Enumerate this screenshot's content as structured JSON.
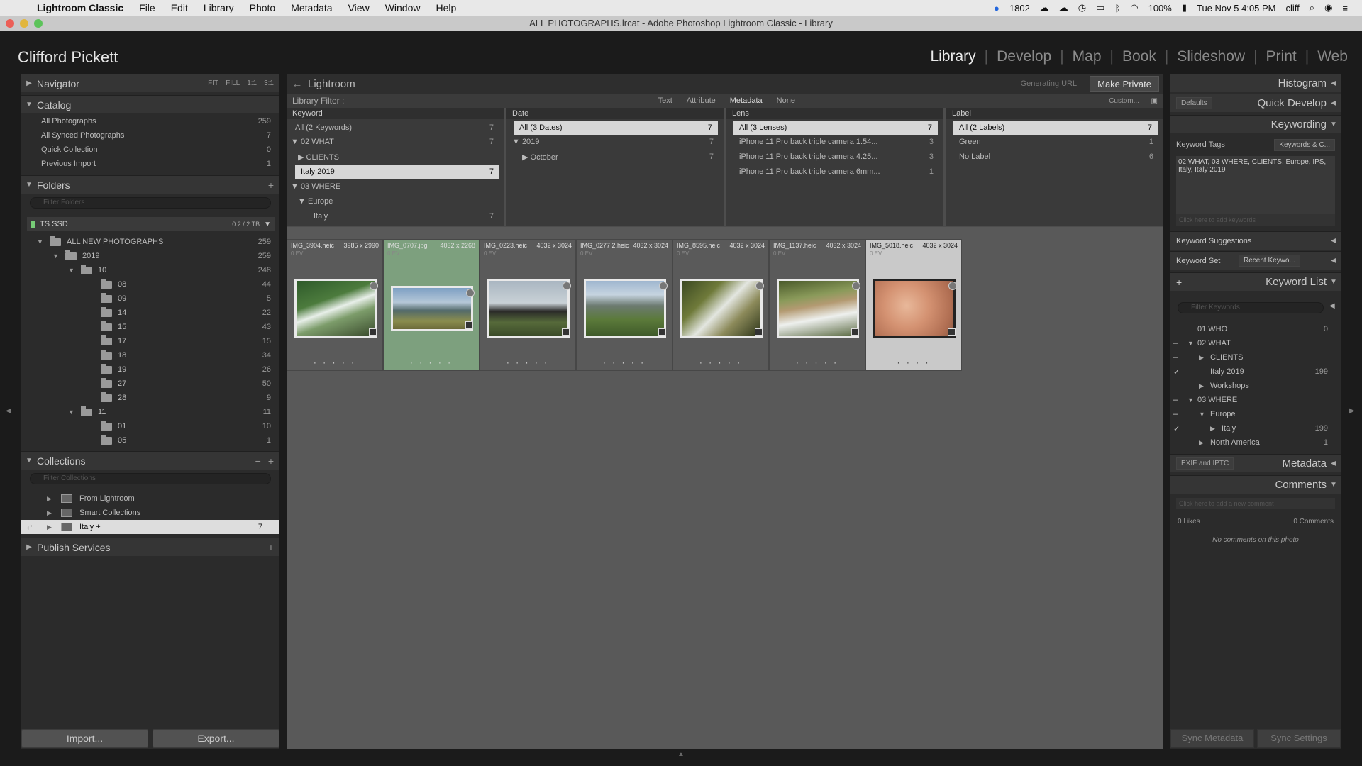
{
  "menubar": {
    "app": "Lightroom Classic",
    "items": [
      "File",
      "Edit",
      "Library",
      "Photo",
      "Metadata",
      "View",
      "Window",
      "Help"
    ],
    "status": {
      "count": "1802",
      "battery": "100%",
      "datetime": "Tue Nov 5  4:05 PM",
      "user": "cliff"
    }
  },
  "window": {
    "title": "ALL PHOTOGRAPHS.lrcat - Adobe Photoshop Lightroom Classic - Library"
  },
  "identity": {
    "plate": "Clifford Pickett"
  },
  "modules": [
    "Library",
    "Develop",
    "Map",
    "Book",
    "Slideshow",
    "Print",
    "Web"
  ],
  "left": {
    "navigator": {
      "title": "Navigator",
      "zoom": [
        "FIT",
        "FILL",
        "1:1",
        "3:1"
      ]
    },
    "catalog": {
      "title": "Catalog",
      "items": [
        {
          "label": "All Photographs",
          "count": "259"
        },
        {
          "label": "All Synced Photographs",
          "count": "7"
        },
        {
          "label": "Quick Collection",
          "count": "0"
        },
        {
          "label": "Previous Import",
          "count": "1"
        }
      ]
    },
    "folders": {
      "title": "Folders",
      "filter": "Filter Folders",
      "volume": "TS SSD",
      "volume_size": "0.2 / 2 TB",
      "tree": [
        {
          "name": "ALL NEW PHOTOGRAPHS",
          "count": "259"
        },
        {
          "name": "2019",
          "count": "259"
        },
        {
          "name": "10",
          "count": "248"
        },
        {
          "name": "08",
          "count": "44"
        },
        {
          "name": "09",
          "count": "5"
        },
        {
          "name": "14",
          "count": "22"
        },
        {
          "name": "15",
          "count": "43"
        },
        {
          "name": "17",
          "count": "15"
        },
        {
          "name": "18",
          "count": "34"
        },
        {
          "name": "19",
          "count": "26"
        },
        {
          "name": "27",
          "count": "50"
        },
        {
          "name": "28",
          "count": "9"
        },
        {
          "name": "11",
          "count": "11"
        },
        {
          "name": "01",
          "count": "10"
        },
        {
          "name": "05",
          "count": "1"
        }
      ]
    },
    "collections": {
      "title": "Collections",
      "filter": "Filter Collections",
      "items": [
        {
          "name": "From Lightroom",
          "count": ""
        },
        {
          "name": "Smart Collections",
          "count": ""
        },
        {
          "name": "Italy +",
          "count": "7"
        }
      ]
    },
    "publish": {
      "title": "Publish Services"
    },
    "import": "Import...",
    "export": "Export..."
  },
  "center": {
    "source": "Lightroom",
    "generating": "Generating URL",
    "make_private": "Make Private",
    "filter": {
      "label": "Library Filter :",
      "tabs": [
        "Text",
        "Attribute",
        "Metadata",
        "None"
      ],
      "preset": "Custom..."
    },
    "columns": [
      {
        "header": "Keyword",
        "rows": [
          {
            "v": "All (2 Keywords)",
            "c": "7"
          },
          {
            "v": "▼ 02 WHAT",
            "c": "7"
          },
          {
            "v": "▶ CLIENTS",
            "c": ""
          },
          {
            "v": "Italy 2019",
            "c": "7"
          },
          {
            "v": "▼ 03 WHERE",
            "c": ""
          },
          {
            "v": "▼ Europe",
            "c": ""
          },
          {
            "v": "Italy",
            "c": "7"
          }
        ]
      },
      {
        "header": "Date",
        "rows": [
          {
            "v": "All (3 Dates)",
            "c": "7"
          },
          {
            "v": "▼ 2019",
            "c": "7"
          },
          {
            "v": "▶ October",
            "c": "7"
          }
        ]
      },
      {
        "header": "Lens",
        "rows": [
          {
            "v": "All (3 Lenses)",
            "c": "7"
          },
          {
            "v": "iPhone 11 Pro back triple camera 1.54...",
            "c": "3"
          },
          {
            "v": "iPhone 11 Pro back triple camera 4.25...",
            "c": "3"
          },
          {
            "v": "iPhone 11 Pro back triple camera 6mm...",
            "c": "1"
          }
        ]
      },
      {
        "header": "Label",
        "rows": [
          {
            "v": "All (2 Labels)",
            "c": "7"
          },
          {
            "v": "Green",
            "c": "1"
          },
          {
            "v": "No Label",
            "c": "6"
          }
        ]
      }
    ],
    "photos": [
      {
        "file": "IMG_3904.heic",
        "dim": "3985 x 2990",
        "ev": "0 EV"
      },
      {
        "file": "IMG_0707.jpg",
        "dim": "4032 x 2268",
        "ev": "0 EV"
      },
      {
        "file": "IMG_0223.heic",
        "dim": "4032 x 3024",
        "ev": "0 EV"
      },
      {
        "file": "IMG_0277 2.heic",
        "dim": "4032 x 3024",
        "ev": "0 EV"
      },
      {
        "file": "IMG_8595.heic",
        "dim": "4032 x 3024",
        "ev": "0 EV"
      },
      {
        "file": "IMG_1137.heic",
        "dim": "4032 x 3024",
        "ev": "0 EV"
      },
      {
        "file": "IMG_5018.heic",
        "dim": "4032 x 3024",
        "ev": "0 EV"
      }
    ]
  },
  "right": {
    "histogram": "Histogram",
    "quick_develop": "Quick Develop",
    "qd_preset": "Defaults",
    "keywording": "Keywording",
    "kw_tags_label": "Keyword Tags",
    "kw_tags_value": "Keywords & C...",
    "kw_text": "02 WHAT, 03 WHERE, CLIENTS, Europe, IPS, Italy, Italy 2019",
    "kw_add": "Click here to add keywords",
    "kw_suggestions": "Keyword Suggestions",
    "kw_set_label": "Keyword Set",
    "kw_set_value": "Recent Keywo...",
    "keyword_list": "Keyword List",
    "kw_filter": "Filter Keywords",
    "kw_items": [
      {
        "k": "01 WHO",
        "n": "0"
      },
      {
        "k": "02 WHAT",
        "n": ""
      },
      {
        "k": "CLIENTS",
        "n": ""
      },
      {
        "k": "Italy 2019",
        "n": "199"
      },
      {
        "k": "Workshops",
        "n": ""
      },
      {
        "k": "03 WHERE",
        "n": ""
      },
      {
        "k": "Europe",
        "n": ""
      },
      {
        "k": "Italy",
        "n": "199"
      },
      {
        "k": "North America",
        "n": "1"
      }
    ],
    "metadata": "Metadata",
    "metadata_preset": "EXIF and IPTC",
    "comments": "Comments",
    "comments_add": "Click here to add a new comment",
    "likes": "0 Likes",
    "comments_count": "0 Comments",
    "no_comments": "No comments on this photo",
    "sync_metadata": "Sync Metadata",
    "sync_settings": "Sync Settings"
  }
}
